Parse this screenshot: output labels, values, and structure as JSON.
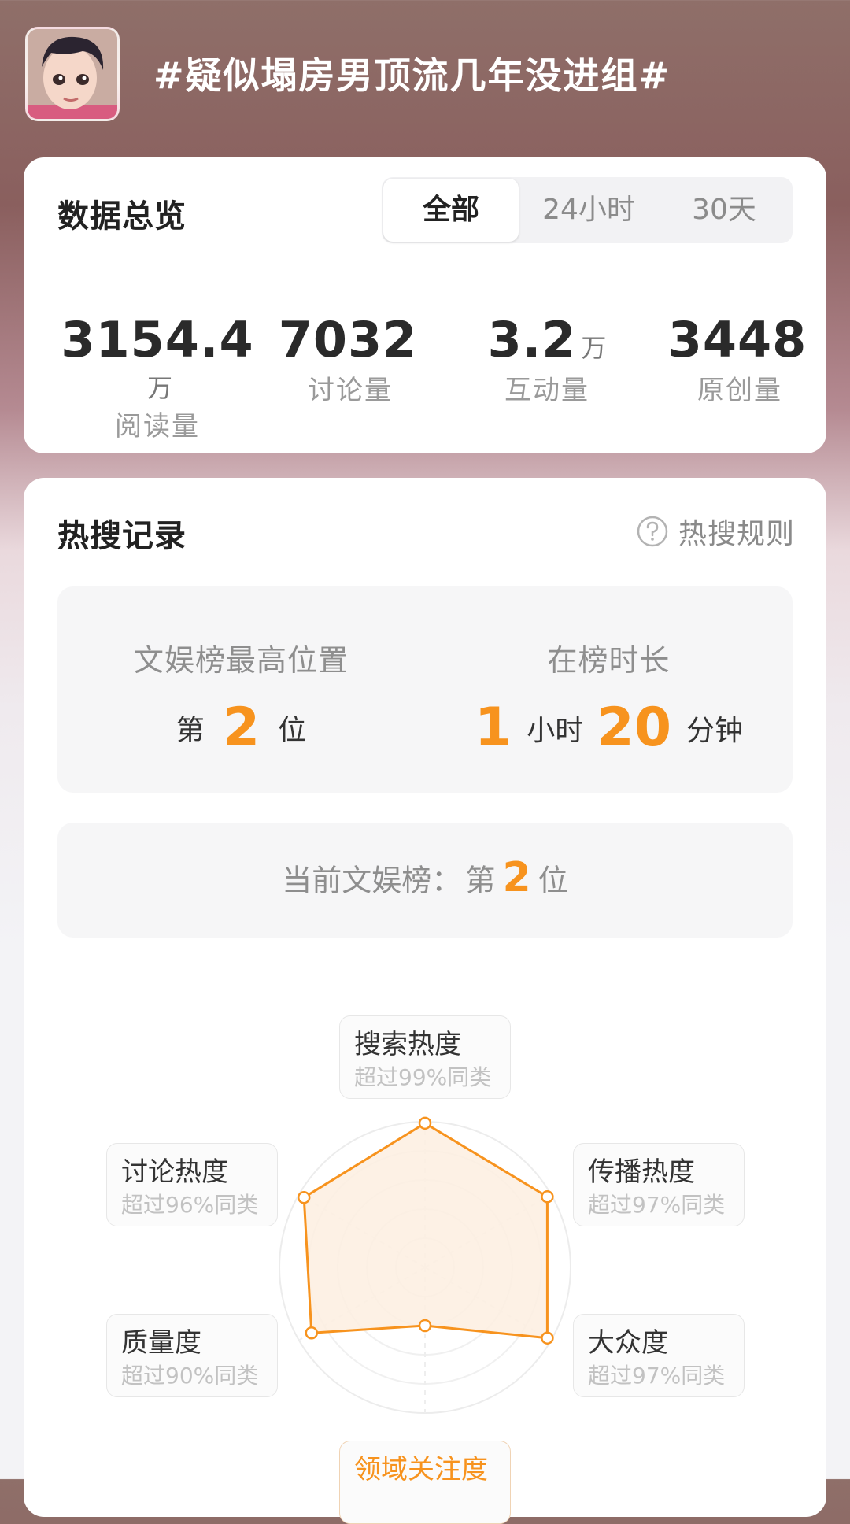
{
  "header": {
    "topic": "#疑似塌房男顶流几年没进组#",
    "avatar_icon": "cartoon-avatar-icon"
  },
  "overview": {
    "title": "数据总览",
    "tabs": [
      {
        "label": "全部",
        "active": true
      },
      {
        "label": "24小时",
        "active": false
      },
      {
        "label": "30天",
        "active": false
      }
    ],
    "stats": [
      {
        "value": "3154.4",
        "unit": "万",
        "label": "阅读量"
      },
      {
        "value": "7032",
        "unit": "",
        "label": "讨论量"
      },
      {
        "value": "3.2",
        "unit": "万",
        "label": "互动量"
      },
      {
        "value": "3448",
        "unit": "",
        "label": "原创量"
      }
    ]
  },
  "hot_search": {
    "title": "热搜记录",
    "rules_label": "热搜规则",
    "rules_icon": "question-circle-icon",
    "highest": {
      "label": "文娱榜最高位置",
      "prefix": "第",
      "value": "2",
      "suffix": "位"
    },
    "duration": {
      "label": "在榜时长",
      "hours": "1",
      "hours_unit": "小时",
      "minutes": "20",
      "minutes_unit": "分钟"
    },
    "current": {
      "label": "当前文娱榜：",
      "prefix": "第",
      "value": "2",
      "suffix": "位"
    },
    "radar": {
      "accent": "#f7931e",
      "fill": "#fdeee0",
      "axes": [
        {
          "name": "搜索热度",
          "sub": "超过99%同类",
          "percent": 99
        },
        {
          "name": "传播热度",
          "sub": "超过97%同类",
          "percent": 97
        },
        {
          "name": "大众度",
          "sub": "超过97%同类",
          "percent": 97
        },
        {
          "name": "领域关注度",
          "sub": "",
          "percent": 40
        },
        {
          "name": "质量度",
          "sub": "超过90%同类",
          "percent": 90
        },
        {
          "name": "讨论热度",
          "sub": "超过96%同类",
          "percent": 96
        }
      ]
    }
  }
}
